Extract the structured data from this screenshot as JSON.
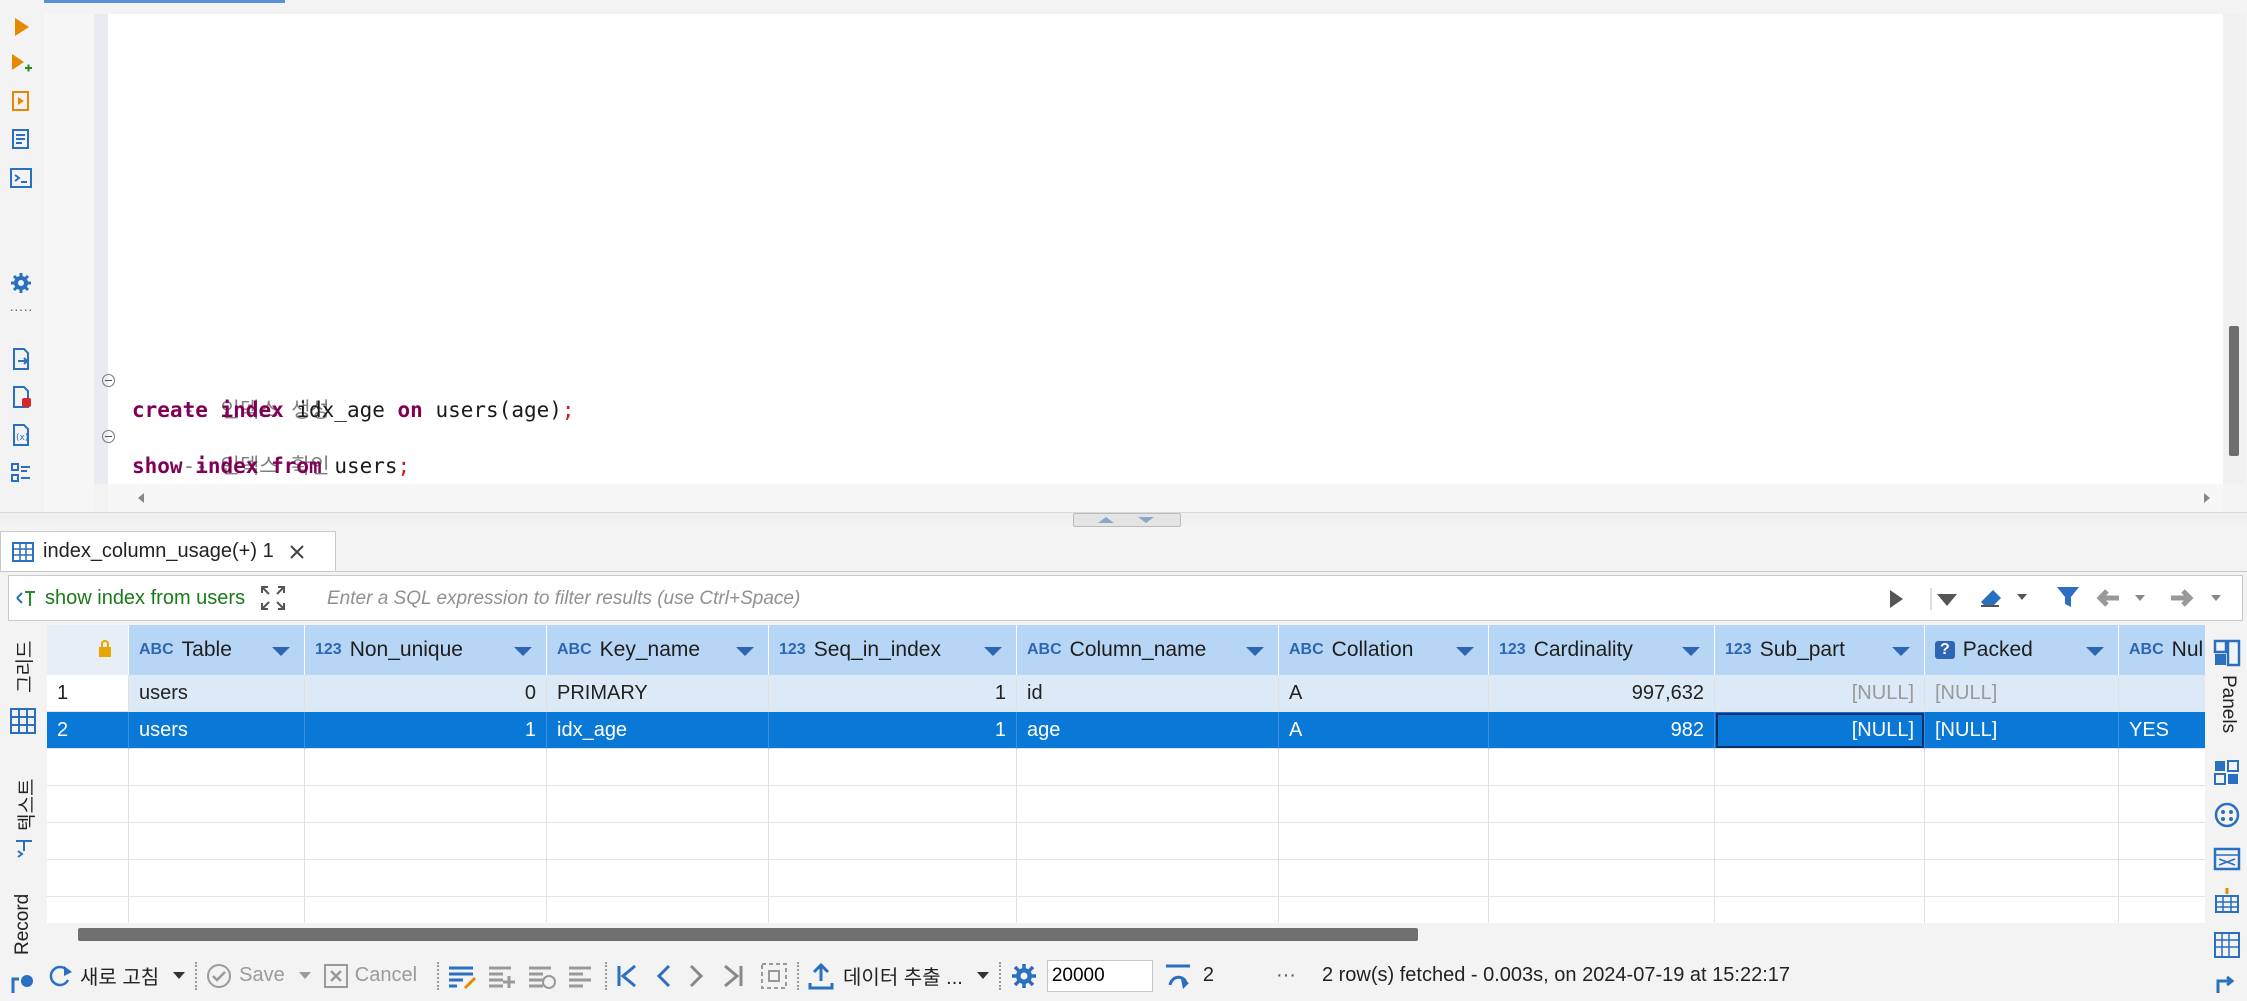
{
  "colors": {
    "accent": "#0a78d6",
    "header_bg": "#b7d6f5",
    "keyword": "#7f0055",
    "comment": "#7f7f7f"
  },
  "editor": {
    "lines": [
      {
        "kind": "comment",
        "text": "-- 인덱스 생성"
      },
      {
        "kind": "code",
        "kw1": "create",
        "kw2": "index",
        "rest1": " idx_age ",
        "kw3": "on",
        "rest2": " users(age)",
        "punct": ";"
      },
      {
        "kind": "comment",
        "text": "-- 인덱스 확인"
      },
      {
        "kind": "code",
        "kw1": "show",
        "kw2": "index",
        "kw3": "from",
        "rest2": " users",
        "punct": ";"
      }
    ]
  },
  "results": {
    "tab_label": "index_column_usage(+) 1",
    "query": "show index from users",
    "filter_placeholder": "Enter a SQL expression to filter results (use Ctrl+Space)",
    "columns": [
      {
        "type": "ABC",
        "name": "Table"
      },
      {
        "type": "123",
        "name": "Non_unique"
      },
      {
        "type": "ABC",
        "name": "Key_name"
      },
      {
        "type": "123",
        "name": "Seq_in_index"
      },
      {
        "type": "ABC",
        "name": "Column_name"
      },
      {
        "type": "ABC",
        "name": "Collation"
      },
      {
        "type": "123",
        "name": "Cardinality"
      },
      {
        "type": "123",
        "name": "Sub_part"
      },
      {
        "type": "?",
        "name": "Packed"
      },
      {
        "type": "ABC",
        "name": "Nul"
      }
    ],
    "rows": [
      {
        "num": "1",
        "cells": [
          "users",
          "0",
          "PRIMARY",
          "1",
          "id",
          "A",
          "997,632",
          "[NULL]",
          "[NULL]",
          ""
        ]
      },
      {
        "num": "2",
        "cells": [
          "users",
          "1",
          "idx_age",
          "1",
          "age",
          "A",
          "982",
          "[NULL]",
          "[NULL]",
          "YES"
        ]
      }
    ]
  },
  "side_tabs": {
    "grid": "그리드",
    "text": "텍스트",
    "record": "Record",
    "panels": "Panels"
  },
  "toolbar": {
    "refresh": "새로 고침",
    "save": "Save",
    "cancel": "Cancel",
    "export": "데이터 추출 ...",
    "fetch_size": "20000",
    "row_count": "2",
    "more": "···",
    "status": "2 row(s) fetched - 0.003s, on 2024-07-19 at 15:22:17"
  }
}
